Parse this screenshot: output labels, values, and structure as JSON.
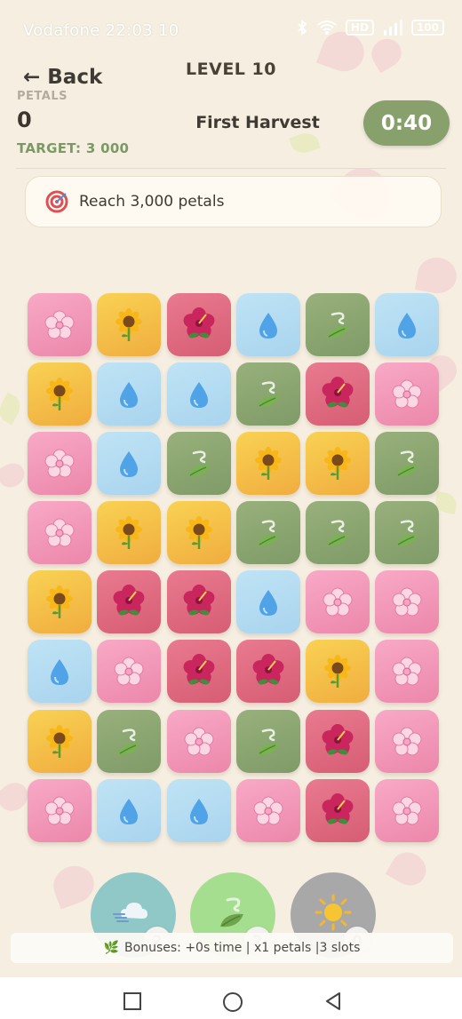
{
  "status_bar": {
    "carrier_time": "Vodafone 22:03 10",
    "icons": [
      "bluetooth-icon",
      "wifi-icon",
      "volte-icon",
      "signal-icon",
      "battery-icon"
    ],
    "battery": "100"
  },
  "header": {
    "back_label": "← Back",
    "level": "LEVEL 10",
    "petals_label": "PETALS",
    "petals_value": "0",
    "target": "TARGET: 3 000",
    "level_name": "First Harvest",
    "timer": "0:40"
  },
  "goal": {
    "icon": "target-icon",
    "text": "Reach 3,000 petals"
  },
  "board": {
    "rows": [
      [
        "blossom",
        "sunflower",
        "hibiscus",
        "water",
        "leaf",
        "water"
      ],
      [
        "sunflower",
        "water",
        "water",
        "leaf",
        "hibiscus",
        "blossom"
      ],
      [
        "blossom",
        "water",
        "leaf",
        "sunflower",
        "sunflower",
        "leaf"
      ],
      [
        "blossom",
        "sunflower",
        "sunflower",
        "leaf",
        "leaf",
        "leaf"
      ],
      [
        "sunflower",
        "hibiscus",
        "hibiscus",
        "water",
        "blossom",
        "blossom"
      ],
      [
        "water",
        "blossom",
        "hibiscus",
        "hibiscus",
        "sunflower",
        "blossom"
      ],
      [
        "sunflower",
        "leaf",
        "blossom",
        "leaf",
        "hibiscus",
        "blossom"
      ],
      [
        "blossom",
        "water",
        "water",
        "blossom",
        "hibiscus",
        "blossom"
      ]
    ]
  },
  "powerups": [
    {
      "icon": "wind-cloud-icon",
      "count": "2",
      "color": "#8fc8c6"
    },
    {
      "icon": "leaf-swirl-icon",
      "count": "2",
      "color": "#a5de8f"
    },
    {
      "icon": "sun-icon",
      "count": "0",
      "color": "#a8a8a8"
    }
  ],
  "bonus_bar": {
    "icon": "🌿",
    "text": "Bonuses: +0s time | x1 petals |3 slots"
  },
  "nav": [
    "recent-apps-icon",
    "home-icon",
    "back-icon"
  ]
}
